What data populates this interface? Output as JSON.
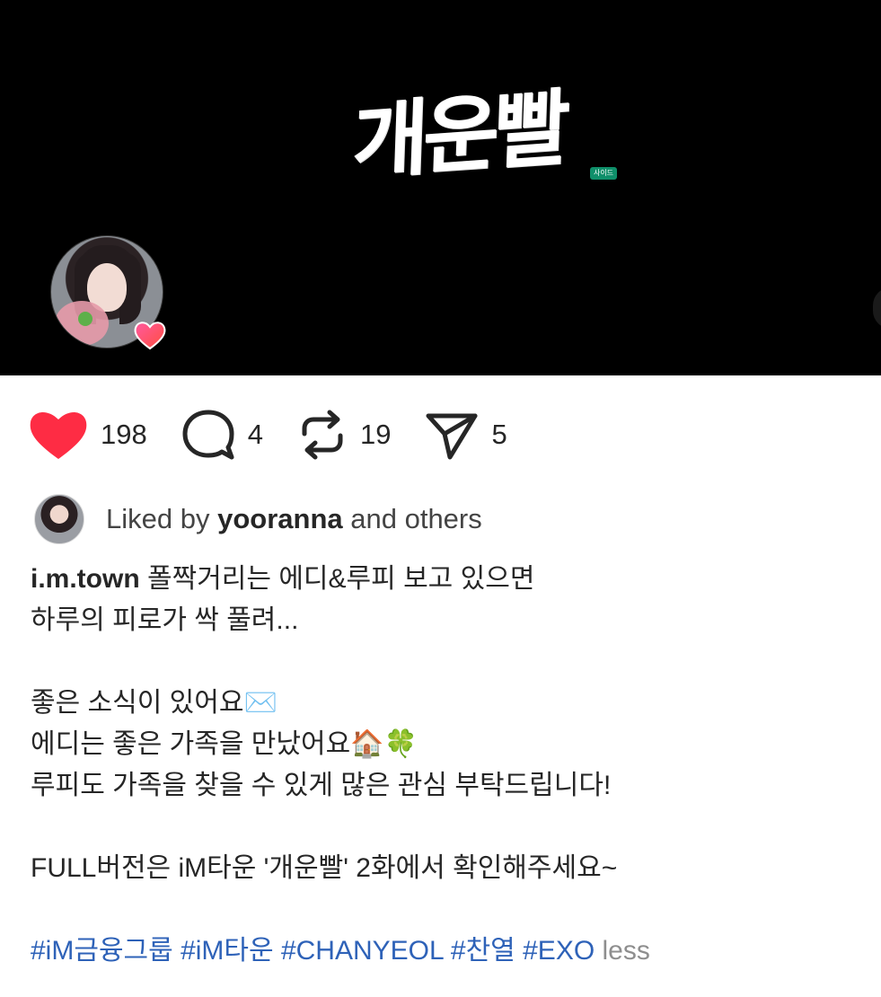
{
  "media": {
    "title_art": "개운빨",
    "title_badge": "사이드"
  },
  "actions": {
    "like_count": "198",
    "comment_count": "4",
    "repost_count": "19",
    "share_count": "5"
  },
  "liked_by": {
    "prefix": "Liked by",
    "user": "yooranna",
    "suffix": "and others"
  },
  "caption": {
    "username": "i.m.town",
    "line1": "폴짝거리는 에디&루피 보고 있으면",
    "line2": "하루의 피로가 싹 풀려...",
    "line3_text": "좋은 소식이 있어요",
    "line3_emoji": "✉️",
    "line4_text": "에디는 좋은 가족을 만났어요",
    "line4_emoji": "🏠🍀",
    "line5": "루피도 가족을 찾을 수 있게 많은 관심 부탁드립니다!",
    "line6": "FULL버전은 iM타운 '개운빨' 2화에서 확인해주세요~",
    "hashtags": "#iM금융그룹 #iM타운 #CHANYEOL #찬열 #EXO",
    "less_label": "less"
  },
  "colors": {
    "like": "#fe2c44",
    "hashtag": "#2e62b8",
    "media_bg": "#000000"
  },
  "icons": [
    "heart-icon",
    "comment-icon",
    "repost-icon",
    "send-icon"
  ]
}
